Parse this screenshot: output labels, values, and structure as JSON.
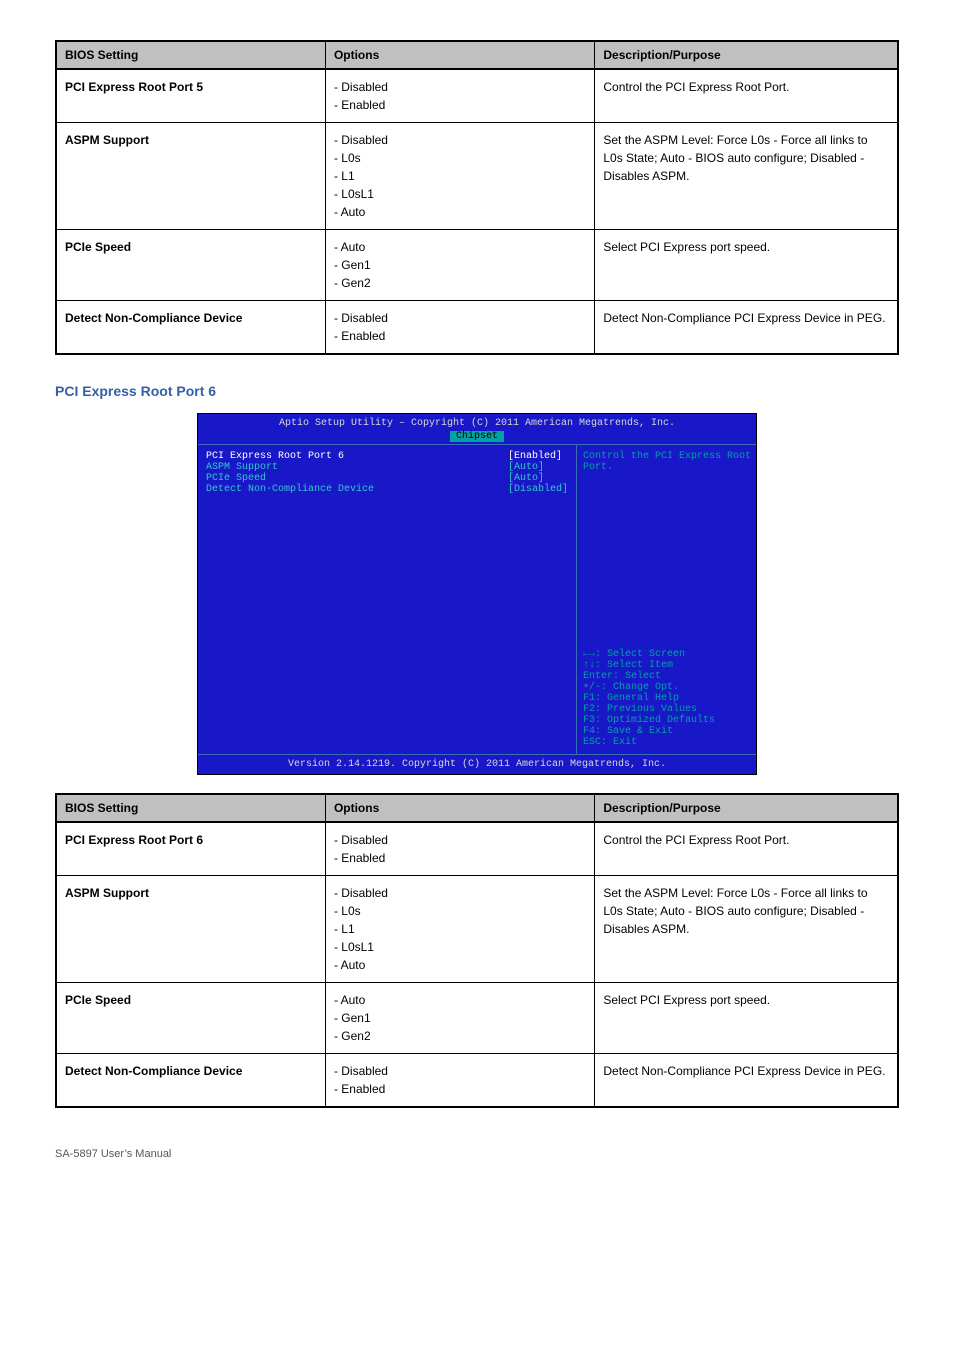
{
  "table1": {
    "columns": [
      "BIOS Setting",
      "Options",
      "Description/Purpose"
    ],
    "rows": [
      {
        "setting": "PCI Express Root Port 5",
        "options": "- Disabled\n- Enabled",
        "desc": "Control the PCI Express Root Port."
      },
      {
        "setting": "ASPM Support",
        "options": "- Disabled\n- L0s\n- L1\n- L0sL1\n- Auto",
        "desc": "Set the ASPM Level: Force L0s - Force all links to L0s State; Auto - BIOS auto configure; Disabled - Disables ASPM."
      },
      {
        "setting": "PCIe Speed",
        "options": "- Auto\n- Gen1\n- Gen2",
        "desc": "Select PCI Express port speed."
      },
      {
        "setting": "Detect Non-Compliance Device",
        "options": "- Disabled\n- Enabled",
        "desc": "Detect Non-Compliance PCI Express Device in PEG."
      }
    ]
  },
  "section_title": "PCI Express Root Port 6",
  "bios": {
    "header": "Aptio Setup Utility – Copyright (C) 2011 American Megatrends, Inc.",
    "tab": "Chipset",
    "items": [
      {
        "label": "PCI Express Root Port 6",
        "value": "[Enabled]",
        "selected": true
      },
      {
        "label": "ASPM Support",
        "value": "[Auto]"
      },
      {
        "label": "PCIe Speed",
        "value": "[Auto]"
      },
      {
        "label": "Detect Non-Compliance Device",
        "value": "[Disabled]"
      }
    ],
    "help": "Control the PCI Express Root\nPort.",
    "hotkeys": "←→: Select Screen\n↑↓: Select Item\nEnter: Select\n+/-: Change Opt.\nF1: General Help\nF2: Previous Values\nF3: Optimized Defaults\nF4: Save & Exit\nESC: Exit",
    "footer": "Version 2.14.1219. Copyright (C) 2011 American Megatrends, Inc."
  },
  "table2": {
    "columns": [
      "BIOS Setting",
      "Options",
      "Description/Purpose"
    ],
    "rows": [
      {
        "setting": "PCI Express Root Port 6",
        "options": "- Disabled\n- Enabled",
        "desc": "Control the PCI Express Root Port."
      },
      {
        "setting": "ASPM Support",
        "options": "- Disabled\n- L0s\n- L1\n- L0sL1\n- Auto",
        "desc": "Set the ASPM Level: Force L0s - Force all links to L0s State; Auto - BIOS auto configure; Disabled - Disables ASPM."
      },
      {
        "setting": "PCIe Speed",
        "options": "- Auto\n- Gen1\n- Gen2",
        "desc": "Select PCI Express port speed."
      },
      {
        "setting": "Detect Non-Compliance Device",
        "options": "- Disabled\n- Enabled",
        "desc": "Detect Non-Compliance PCI Express Device in PEG."
      }
    ]
  },
  "page_footer": "SA-5897 User’s Manual"
}
